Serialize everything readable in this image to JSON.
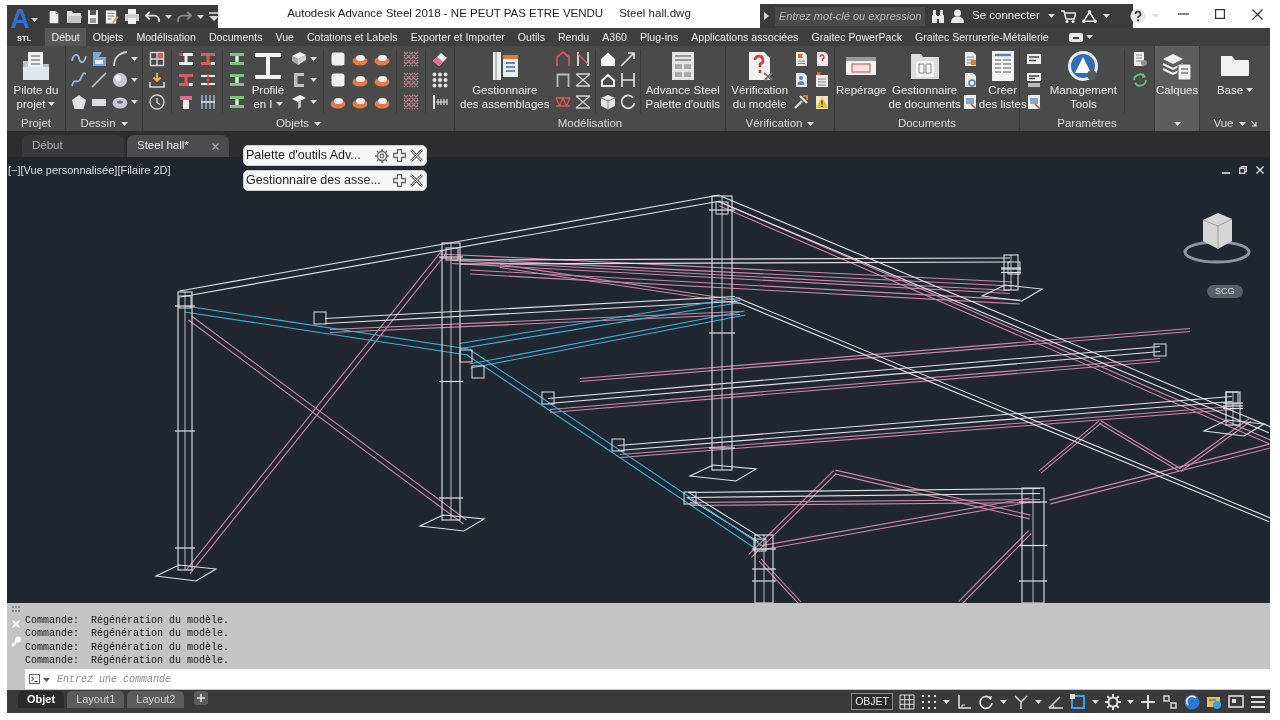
{
  "app_button": {
    "letter": "A",
    "caption": "STL"
  },
  "title_bar": {
    "title": "Autodesk Advance Steel 2018 - NE PEUT PAS ETRE VENDU",
    "file_name": "Steel hall.dwg",
    "search": {
      "placeholder": "Entrez mot-clé ou expression"
    },
    "sign_in": "Se connecter"
  },
  "ribbon_tabs": [
    {
      "label": "Début",
      "selected": true
    },
    {
      "label": "Objets",
      "selected": false
    },
    {
      "label": "Modélisation",
      "selected": false
    },
    {
      "label": "Documents",
      "selected": false
    },
    {
      "label": "Vue",
      "selected": false
    },
    {
      "label": "Cotations et Labels",
      "selected": false
    },
    {
      "label": "Exporter et Importer",
      "selected": false
    },
    {
      "label": "Outils",
      "selected": false
    },
    {
      "label": "Rendu",
      "selected": false
    },
    {
      "label": "A360",
      "selected": false
    },
    {
      "label": "Plug-ins",
      "selected": false
    },
    {
      "label": "Applications associées",
      "selected": false
    },
    {
      "label": "Graitec PowerPack",
      "selected": false
    },
    {
      "label": "Graitec Serrurerie-Métallerie",
      "selected": false
    }
  ],
  "ribbon_panels": [
    {
      "label": "Projet",
      "menu": false,
      "launcher": false,
      "highlighted": false,
      "buttons": [
        {
          "label_lines": [
            "Pilote du",
            "projet"
          ],
          "dropdown": true
        }
      ]
    },
    {
      "label": "Dessin",
      "menu": true,
      "launcher": false,
      "highlighted": false
    },
    {
      "label": "Objets",
      "menu": true,
      "launcher": false,
      "highlighted": false,
      "buttons": [
        {
          "label_lines": [
            "Profilé",
            "en I"
          ],
          "dropdown": true
        }
      ]
    },
    {
      "label": "Modélisation",
      "menu": false,
      "launcher": false,
      "highlighted": false,
      "buttons": [
        {
          "label_lines": [
            "Gestionnaire",
            "des assemblages"
          ],
          "dropdown": false
        },
        {
          "label_lines": [
            "Advance Steel",
            "Palette d'outils"
          ],
          "dropdown": false
        }
      ]
    },
    {
      "label": "Vérification",
      "menu": true,
      "launcher": false,
      "highlighted": false,
      "buttons": [
        {
          "label_lines": [
            "Vérification",
            "du modèle"
          ],
          "dropdown": false
        }
      ]
    },
    {
      "label": "Documents",
      "menu": false,
      "launcher": false,
      "highlighted": false,
      "buttons": [
        {
          "label_lines": [
            "Repérage"
          ],
          "dropdown": false
        },
        {
          "label_lines": [
            "Gestionnaire",
            "de documents"
          ],
          "dropdown": false
        },
        {
          "label_lines": [
            "Créer",
            "des listes"
          ],
          "dropdown": false
        }
      ]
    },
    {
      "label": "Paramètres",
      "menu": false,
      "launcher": false,
      "highlighted": false,
      "buttons": [
        {
          "label_lines": [
            "Management",
            "Tools"
          ],
          "dropdown": false
        }
      ]
    },
    {
      "menu": true,
      "launcher": false,
      "highlighted": true,
      "buttons": [
        {
          "label_lines": [
            "Calques"
          ],
          "dropdown": false
        }
      ]
    },
    {
      "label": "Vue",
      "menu": true,
      "launcher": true,
      "highlighted": false,
      "buttons": [
        {
          "label_lines": [
            "Base"
          ],
          "dropdown": true
        }
      ]
    }
  ],
  "doc_tabs": [
    {
      "label": "Début",
      "selected": false,
      "closable": false
    },
    {
      "label": "Steel hall*",
      "selected": true,
      "closable": true
    }
  ],
  "palettes": [
    {
      "label": "Palette d'outils Adv...",
      "settings": true
    },
    {
      "label": "Gestionnaire des asse...",
      "settings": false
    }
  ],
  "viewport": {
    "controls": [
      "[−]",
      "[Vue personnalisée]",
      "[Filaire 2D]"
    ],
    "ucs_button": "SCG"
  },
  "command_line": {
    "history": [
      "Commande:  Régénération du modèle.",
      "Commande:  Régénération du modèle.",
      "Commande:  Régénération du modèle.",
      "Commande:  Régénération du modèle."
    ],
    "input": {
      "placeholder": "Entrez une commande"
    }
  },
  "layout_tabs": [
    {
      "label": "Objet",
      "selected": true
    },
    {
      "label": "Layout1",
      "selected": false
    },
    {
      "label": "Layout2",
      "selected": false
    }
  ],
  "status_bar": {
    "model_button": "OBJET"
  }
}
